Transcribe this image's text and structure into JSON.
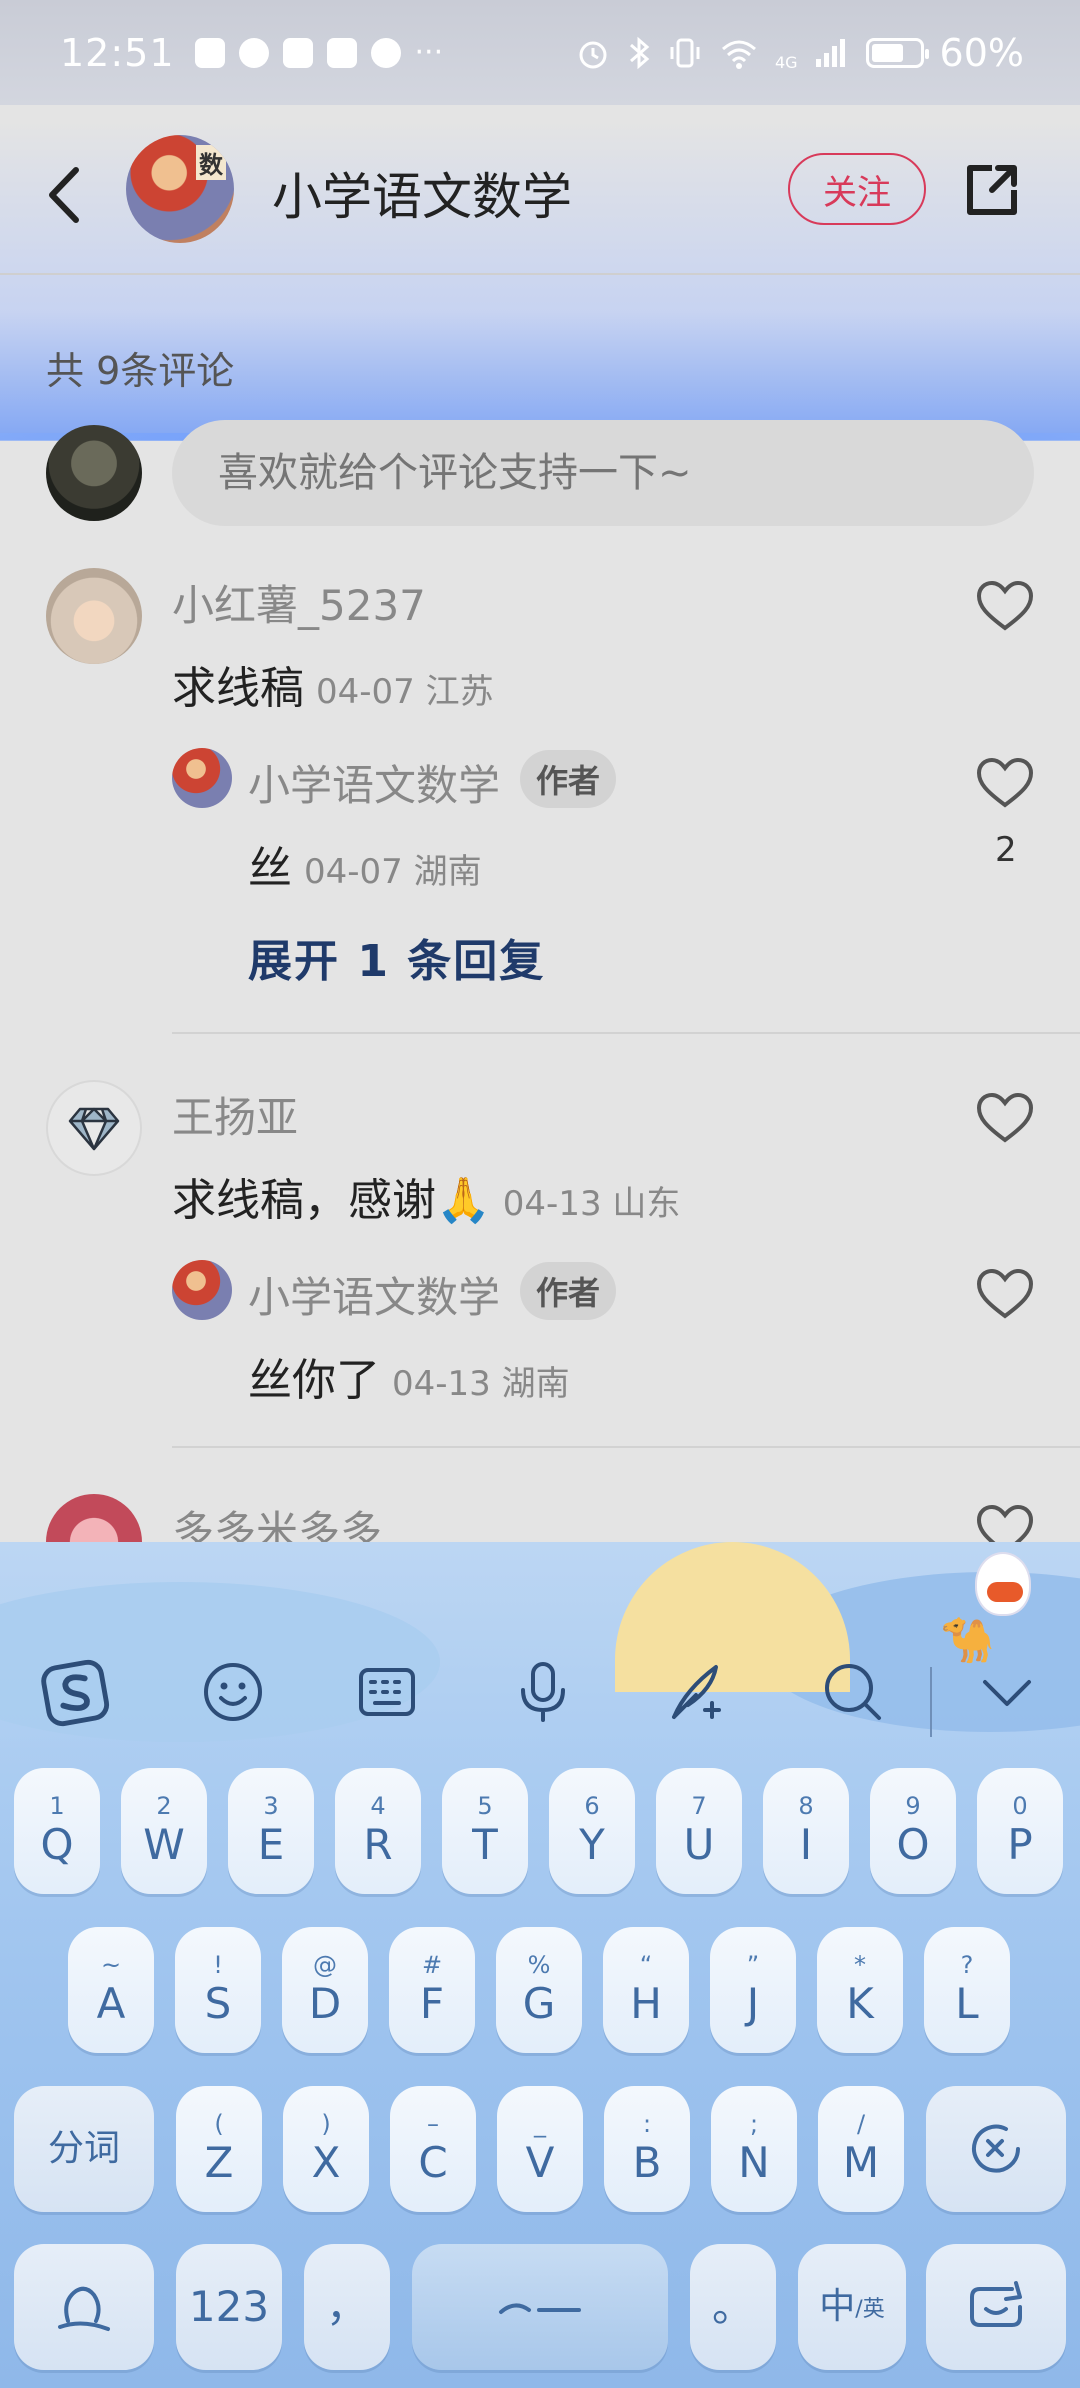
{
  "status_bar": {
    "time": "12:51",
    "network": "4G",
    "battery": "60%",
    "battery_level": 0.6
  },
  "header": {
    "title": "小学语文数学",
    "avatar_tag": "数",
    "follow_label": "关注"
  },
  "comments_section": {
    "count_label": "共 9条评论",
    "input_placeholder": "喜欢就给个评论支持一下~"
  },
  "comments": [
    {
      "username": "小红薯_5237",
      "text": "求线稿",
      "meta": "04-07 江苏",
      "reply": {
        "username": "小学语文数学",
        "badge": "作者",
        "text": "丝",
        "meta": "04-07 湖南",
        "likes": "2"
      },
      "expand_label": "展开 1 条回复"
    },
    {
      "username": "王扬亚",
      "text": "求线稿，感谢🙏",
      "meta": "04-13 山东",
      "reply": {
        "username": "小学语文数学",
        "badge": "作者",
        "text": "丝你了",
        "meta": "04-13 湖南"
      }
    },
    {
      "username": "多多米多多"
    }
  ],
  "keyboard": {
    "row1": [
      {
        "k": "Q",
        "h": "1"
      },
      {
        "k": "W",
        "h": "2"
      },
      {
        "k": "E",
        "h": "3"
      },
      {
        "k": "R",
        "h": "4"
      },
      {
        "k": "T",
        "h": "5"
      },
      {
        "k": "Y",
        "h": "6"
      },
      {
        "k": "U",
        "h": "7"
      },
      {
        "k": "I",
        "h": "8"
      },
      {
        "k": "O",
        "h": "9"
      },
      {
        "k": "P",
        "h": "0"
      }
    ],
    "row2": [
      {
        "k": "A",
        "h": "~"
      },
      {
        "k": "S",
        "h": "!"
      },
      {
        "k": "D",
        "h": "@"
      },
      {
        "k": "F",
        "h": "#"
      },
      {
        "k": "G",
        "h": "%"
      },
      {
        "k": "H",
        "h": "“"
      },
      {
        "k": "J",
        "h": "”"
      },
      {
        "k": "K",
        "h": "*"
      },
      {
        "k": "L",
        "h": "?"
      }
    ],
    "row3": [
      {
        "k": "Z",
        "h": "("
      },
      {
        "k": "X",
        "h": ")"
      },
      {
        "k": "C",
        "h": "–"
      },
      {
        "k": "V",
        "h": "_"
      },
      {
        "k": "B",
        "h": ":"
      },
      {
        "k": "N",
        "h": ";"
      },
      {
        "k": "M",
        "h": "/"
      }
    ],
    "segment_label": "分词",
    "num_label": "123",
    "comma": "，",
    "period": "。",
    "lang_label": "中",
    "lang_sub": "/英"
  }
}
